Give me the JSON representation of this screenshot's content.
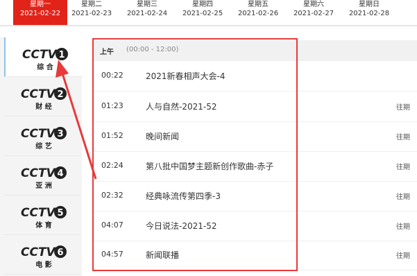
{
  "dates": [
    {
      "weekday": "星期一",
      "date": "2021-02-22",
      "active": true
    },
    {
      "weekday": "星期二",
      "date": "2021-02-23",
      "active": false
    },
    {
      "weekday": "星期三",
      "date": "2021-02-24",
      "active": false
    },
    {
      "weekday": "星期四",
      "date": "2021-02-25",
      "active": false
    },
    {
      "weekday": "星期五",
      "date": "2021-02-26",
      "active": false
    },
    {
      "weekday": "星期六",
      "date": "2021-02-27",
      "active": false
    },
    {
      "weekday": "星期日",
      "date": "2021-02-28",
      "active": false
    }
  ],
  "channels": [
    {
      "logo_text": "CCTV",
      "number": "1",
      "name": "综 合",
      "active": true
    },
    {
      "logo_text": "CCTV",
      "number": "2",
      "name": "财 经",
      "active": false
    },
    {
      "logo_text": "CCTV",
      "number": "3",
      "name": "综 艺",
      "active": false
    },
    {
      "logo_text": "CCTV",
      "number": "4",
      "name": "亚 洲",
      "active": false
    },
    {
      "logo_text": "CCTV",
      "number": "5",
      "name": "体 育",
      "active": false
    },
    {
      "logo_text": "CCTV",
      "number": "6",
      "name": "电 影",
      "active": false
    }
  ],
  "schedule": {
    "period_label": "上午",
    "period_range": "(00:00 - 12:00)",
    "programs": [
      {
        "time": "00:22",
        "title": "2021新春相声大会-4",
        "past_label": ""
      },
      {
        "time": "01:23",
        "title": "人与自然-2021-52",
        "past_label": "往期"
      },
      {
        "time": "01:52",
        "title": "晚间新闻",
        "past_label": "往期"
      },
      {
        "time": "02:24",
        "title": "第八批中国梦主题新创作歌曲-赤子",
        "past_label": "往期"
      },
      {
        "time": "02:32",
        "title": "经典咏流传第四季-3",
        "past_label": "往期"
      },
      {
        "time": "04:07",
        "title": "今日说法-2021-52",
        "past_label": "往期"
      },
      {
        "time": "04:57",
        "title": "新闻联播",
        "past_label": "往期"
      }
    ]
  },
  "colors": {
    "accent": "#e2231a",
    "annotation": "#e83a3a"
  }
}
